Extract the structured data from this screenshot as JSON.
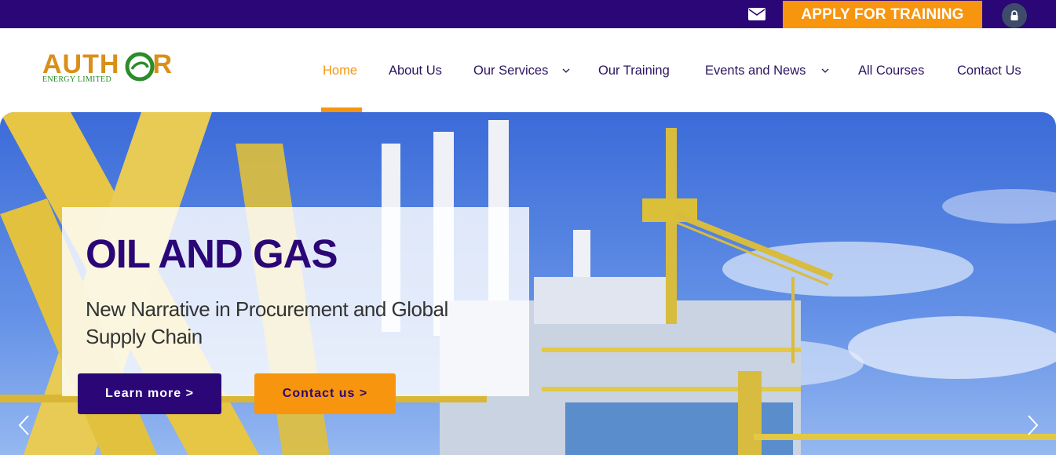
{
  "topbar": {
    "mail_icon": "envelope-icon",
    "apply_label": "APPLY FOR TRAINING",
    "user_icon": "user-lock-icon"
  },
  "logo": {
    "name_part1": "AUTH",
    "name_part2": "R",
    "tagline": "ENERGY LIMITED"
  },
  "nav": {
    "items": [
      {
        "label": "Home",
        "active": true
      },
      {
        "label": "About Us"
      },
      {
        "label": "Our Services",
        "has_dropdown": true
      },
      {
        "label": "Our Training"
      },
      {
        "label": "Events and News",
        "has_dropdown": true
      },
      {
        "label": "All Courses"
      },
      {
        "label": "Contact Us"
      }
    ]
  },
  "hero": {
    "title": "OIL AND GAS",
    "subtitle": "New Narrative in Procurement and Global Supply Chain",
    "learn_more": "Learn more >",
    "contact_us": "Contact us >"
  },
  "colors": {
    "brand_purple": "#2b0677",
    "brand_orange": "#f7950e",
    "logo_green": "#2b8c2b"
  }
}
